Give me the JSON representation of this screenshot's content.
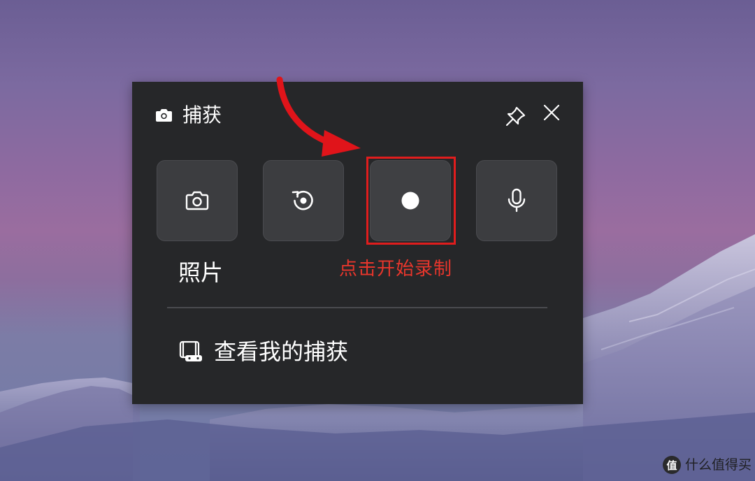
{
  "window": {
    "title": "捕获",
    "title_icon": "camera-icon",
    "pin_icon": "pin-icon",
    "close_icon": "close-icon"
  },
  "actions": [
    {
      "name": "screenshot",
      "icon": "camera-icon",
      "label": "照片"
    },
    {
      "name": "record-last",
      "icon": "replay-icon"
    },
    {
      "name": "start-recording",
      "icon": "record-dot-icon"
    },
    {
      "name": "microphone",
      "icon": "microphone-icon"
    }
  ],
  "annotation": {
    "text": "点击开始录制",
    "color": "#e8362c"
  },
  "footer": {
    "link_label": "查看我的捕获",
    "link_icon": "gallery-icon"
  },
  "watermark": {
    "badge": "值",
    "text": "什么值得买"
  },
  "colors": {
    "panel_bg": "#262729",
    "tile_bg": "#3c3d40",
    "highlight": "#e01d1d",
    "arrow": "#e0141a"
  }
}
